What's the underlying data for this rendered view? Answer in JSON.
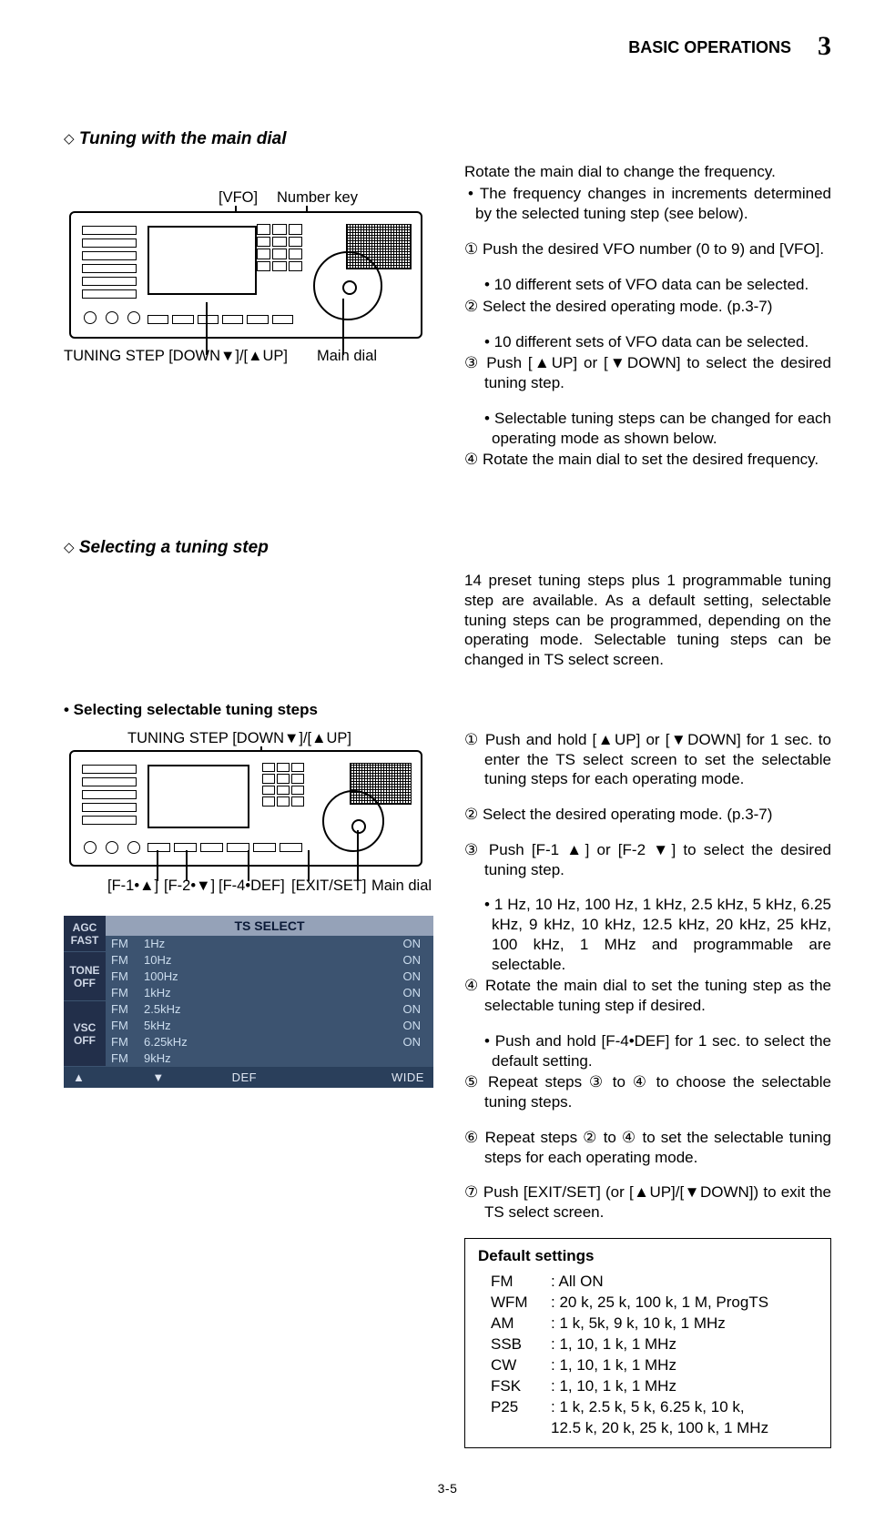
{
  "header": {
    "section": "BASIC OPERATIONS",
    "chapter": "3"
  },
  "section1": {
    "heading": "Tuning with the main dial",
    "intro": "Rotate the main dial to change the frequency.",
    "bullet": "• The frequency changes in increments determined by the selected tuning step (see below).",
    "steps": {
      "s1": "① Push the desired VFO number (0 to 9) and [VFO].",
      "s1_sub": "• 10 different sets of VFO data can be selected.",
      "s2": "② Select the desired operating mode. (p.3-7)",
      "s2_sub": "• 10 different sets of VFO data can be selected.",
      "s3": "③ Push [▲UP] or [▼DOWN] to select the desired tuning step.",
      "s3_sub": "• Selectable tuning steps can be changed for each operating mode as shown below.",
      "s4": "④ Rotate the main dial to set the desired frequency."
    },
    "callouts": {
      "vfo": "[VFO]",
      "numkey": "Number key",
      "tuningstep": "TUNING STEP [DOWN▼]/[▲UP]",
      "maindial": "Main dial"
    }
  },
  "section2": {
    "heading": "Selecting a tuning step",
    "intro": "14 preset tuning steps plus 1 programmable tuning step are available. As a default setting, selectable tuning steps can be programmed, depending on the operating mode. Selectable tuning steps can be changed in TS select screen."
  },
  "section3": {
    "heading": "• Selecting selectable tuning steps",
    "callouts": {
      "tuningstep": "TUNING STEP [DOWN▼]/[▲UP]",
      "f1": "[F-1•▲]",
      "f2": "[F-2•▼]",
      "f4": "[F-4•DEF]",
      "exit": "[EXIT/SET]",
      "maindial": "Main dial"
    },
    "steps": {
      "s1": "① Push and hold [▲UP] or [▼DOWN] for 1 sec. to enter the TS select screen to set the selectable tuning steps for each operating mode.",
      "s2": "② Select the desired operating mode. (p.3-7)",
      "s3": "③ Push [F-1 ▲] or [F-2 ▼] to select the desired tuning step.",
      "s3_sub": "• 1 Hz, 10 Hz, 100 Hz, 1 kHz, 2.5 kHz, 5 kHz, 6.25 kHz, 9 kHz, 10 kHz, 12.5 kHz, 20 kHz, 25 kHz, 100 kHz, 1 MHz and programmable are selectable.",
      "s4": "④ Rotate the main dial to set the tuning step as the selectable tuning step if desired.",
      "s4_sub": "• Push and hold [F-4•DEF] for 1 sec. to select the default setting.",
      "s5": "⑤ Repeat steps ③ to ④ to choose the selectable tuning steps.",
      "s6": "⑥ Repeat steps ② to ④ to set the selectable tuning steps for each operating mode.",
      "s7": "⑦ Push [EXIT/SET] (or [▲UP]/[▼DOWN]) to exit the TS select screen."
    },
    "ts_table": {
      "title": "TS  SELECT",
      "left_labels": [
        "AGC",
        "FAST",
        "TONE",
        "OFF",
        "VSC",
        "OFF"
      ],
      "rows": [
        {
          "mode": "FM",
          "val": "1Hz",
          "on": "ON"
        },
        {
          "mode": "FM",
          "val": "10Hz",
          "on": "ON"
        },
        {
          "mode": "FM",
          "val": "100Hz",
          "on": "ON"
        },
        {
          "mode": "FM",
          "val": "1kHz",
          "on": "ON"
        },
        {
          "mode": "FM",
          "val": "2.5kHz",
          "on": "ON"
        },
        {
          "mode": "FM",
          "val": "5kHz",
          "on": "ON"
        },
        {
          "mode": "FM",
          "val": "6.25kHz",
          "on": "ON"
        },
        {
          "mode": "FM",
          "val": "9kHz",
          "on": ""
        }
      ],
      "footer": [
        "▲",
        "▼",
        "DEF",
        "",
        "WIDE"
      ]
    }
  },
  "default_settings": {
    "title": "Default settings",
    "rows": [
      {
        "mode": "FM",
        "val": ": All ON"
      },
      {
        "mode": "WFM",
        "val": ": 20 k, 25 k, 100 k, 1 M, ProgTS"
      },
      {
        "mode": "AM",
        "val": ": 1 k, 5k, 9 k, 10 k, 1 MHz"
      },
      {
        "mode": "SSB",
        "val": ": 1, 10, 1 k, 1 MHz"
      },
      {
        "mode": "CW",
        "val": ": 1, 10, 1 k, 1 MHz"
      },
      {
        "mode": "FSK",
        "val": ": 1, 10, 1 k, 1 MHz"
      },
      {
        "mode": "P25",
        "val": ": 1 k, 2.5 k, 5 k, 6.25 k, 10 k,"
      }
    ],
    "p25_cont": "  12.5 k, 20 k, 25 k, 100 k, 1 MHz"
  },
  "footer": {
    "page": "3-5"
  }
}
